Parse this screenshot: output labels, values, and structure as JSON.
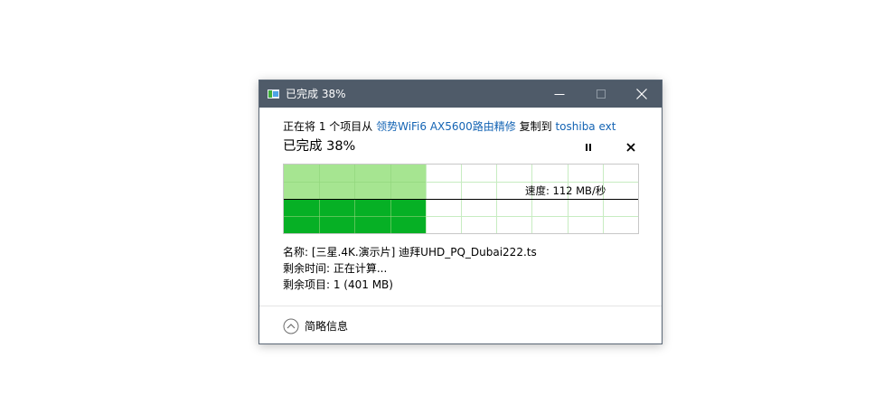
{
  "window": {
    "title": "已完成 38%",
    "minimize_icon": "minimize-icon",
    "maximize_icon": "maximize-icon",
    "close_icon": "close-icon"
  },
  "transfer": {
    "desc_prefix": "正在将 1 个项目从 ",
    "source": "领势WiFi6 AX5600路由精修",
    "desc_middle": " 复制到 ",
    "destination": "toshiba ext",
    "percent_label": "已完成 38%",
    "progress_fraction": 0.38,
    "speed_label": "速度: 112 MB/秒",
    "name_line": "名称: [三星.4K.演示片] 迪拜UHD_PQ_Dubai222.ts",
    "time_left_line": "剩余时间: 正在计算...",
    "items_left_line": "剩余项目: 1 (401 MB)"
  },
  "controls": {
    "pause_icon": "pause-icon",
    "cancel_icon": "cancel-icon"
  },
  "footer": {
    "details_label": "简略信息",
    "details_icon": "chevron-up-circle-icon"
  },
  "colors": {
    "titlebar": "#4f5b69",
    "link": "#1464b4",
    "progress_dark": "#06b025",
    "progress_light": "#a6e591",
    "grid": "#c7ecc1"
  }
}
